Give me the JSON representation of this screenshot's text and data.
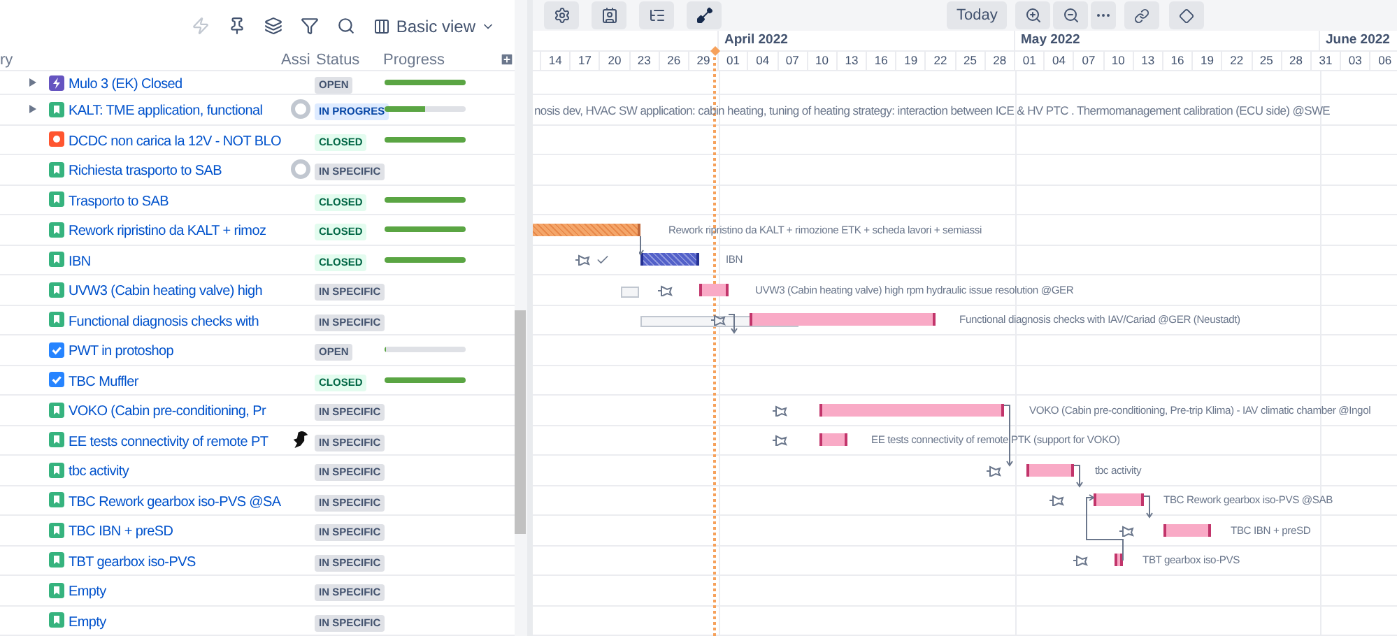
{
  "toolbar": {
    "view_button": "Basic view"
  },
  "table": {
    "columns": [
      "ry",
      "Assi",
      "Status",
      "Progress"
    ],
    "rows": [
      {
        "kind": "epic",
        "summary": "Mulo 3 (EK) Closed",
        "expanded": false,
        "status": {
          "label": "OPEN",
          "kind": "open"
        },
        "progress": {
          "level": 1
        }
      },
      {
        "kind": "story",
        "summary": "KALT: TME application, functional",
        "expanded": false,
        "avatar": {
          "kind": "default"
        },
        "status": {
          "label": "IN PROGRES",
          "kind": "progress"
        },
        "progress": {
          "level": 0.5
        },
        "timeline": {
          "label": "nosis dev, HVAC SW application: cabin heating, tuning of heating strategy: interaction between ICE & HV PTC . Thermomanagement calibration (ECU side) @SWE"
        }
      },
      {
        "kind": "bug",
        "summary": "DCDC non carica la 12V - NOT BLO",
        "status": {
          "label": "CLOSED",
          "kind": "closed"
        },
        "progress": {
          "level": 1
        }
      },
      {
        "kind": "story",
        "summary": "Richiesta trasporto to SAB",
        "avatar": {
          "kind": "default"
        },
        "status": {
          "label": "IN SPECIFIC",
          "kind": "open"
        }
      },
      {
        "kind": "story",
        "summary": "Trasporto to SAB",
        "status": {
          "label": "CLOSED",
          "kind": "closed"
        },
        "progress": {
          "level": 1
        }
      },
      {
        "kind": "story",
        "summary": "Rework ripristino da KALT + rimoz",
        "status": {
          "label": "CLOSED",
          "kind": "closed"
        },
        "progress": {
          "level": 1
        },
        "timeline": {
          "kind": "hatched",
          "label": "Rework ripristino da KALT + rimozione ETK + scheda lavori + semiassi"
        }
      },
      {
        "kind": "story",
        "summary": "IBN",
        "status": {
          "label": "CLOSED",
          "kind": "closed"
        },
        "progress": {
          "level": 1
        },
        "timeline": {
          "kind": "done",
          "label": "IBN"
        }
      },
      {
        "kind": "story",
        "summary": "UVW3 (Cabin heating valve) high",
        "status": {
          "label": "IN SPECIFIC",
          "kind": "open"
        },
        "timeline": {
          "kind": "planned",
          "label": "UVW3 (Cabin heating valve) high rpm hydraulic issue resolution @GER"
        }
      },
      {
        "kind": "story",
        "summary": "Functional diagnosis checks with",
        "status": {
          "label": "IN SPECIFIC",
          "kind": "open"
        },
        "timeline": {
          "kind": "planned",
          "label": "Functional diagnosis checks with IAV/Cariad @GER (Neustadt)"
        }
      },
      {
        "kind": "task",
        "summary": "PWT in protoshop",
        "status": {
          "label": "OPEN",
          "kind": "open"
        },
        "progress": {
          "level": 0
        }
      },
      {
        "kind": "task",
        "summary": "TBC Muffler",
        "status": {
          "label": "CLOSED",
          "kind": "closed"
        },
        "progress": {
          "level": 1
        }
      },
      {
        "kind": "story",
        "summary": "VOKO (Cabin pre-conditioning, Pr",
        "status": {
          "label": "IN SPECIFIC",
          "kind": "open"
        },
        "timeline": {
          "kind": "planned",
          "label": "VOKO (Cabin pre-conditioning, Pre-trip Klima) - IAV climatic chamber @Ingol"
        }
      },
      {
        "kind": "story",
        "summary": "EE tests connectivity of remote PT",
        "status": {
          "label": "IN SPECIFIC",
          "kind": "open"
        },
        "timeline": {
          "kind": "planned",
          "label": "EE tests connectivity of remote PTK (support for VOKO)"
        }
      },
      {
        "kind": "story",
        "summary": "tbc activity",
        "status": {
          "label": "IN SPECIFIC",
          "kind": "open"
        },
        "timeline": {
          "kind": "planned",
          "label": "tbc activity"
        }
      },
      {
        "kind": "story",
        "summary": "TBC Rework gearbox iso-PVS @SA",
        "status": {
          "label": "IN SPECIFIC",
          "kind": "open"
        },
        "timeline": {
          "kind": "planned",
          "label": "TBC Rework gearbox iso-PVS @SAB"
        }
      },
      {
        "kind": "story",
        "summary": "TBC IBN + preSD",
        "status": {
          "label": "IN SPECIFIC",
          "kind": "open"
        },
        "timeline": {
          "kind": "planned",
          "label": "TBC IBN + preSD"
        }
      },
      {
        "kind": "story",
        "summary": "TBT gearbox iso-PVS",
        "status": {
          "label": "IN SPECIFIC",
          "kind": "open"
        },
        "timeline": {
          "kind": "planned",
          "label": "TBT gearbox iso-PVS"
        }
      },
      {
        "kind": "story",
        "summary": "Empty",
        "status": {
          "label": "IN SPECIFIC",
          "kind": "open"
        }
      },
      {
        "kind": "story",
        "summary": "Empty",
        "status": {
          "label": "IN SPECIFIC",
          "kind": "open"
        }
      }
    ]
  },
  "gantt": {
    "today_button": "Today",
    "months": [
      "April 2022",
      "May 2022",
      "June 2022"
    ],
    "days": [
      "14",
      "17",
      "20",
      "23",
      "26",
      "29",
      "01",
      "04",
      "07",
      "10",
      "13",
      "16",
      "19",
      "22",
      "25",
      "28",
      "01",
      "04",
      "07",
      "10",
      "13",
      "16",
      "19",
      "22",
      "25",
      "28",
      "31",
      "03",
      "06"
    ]
  }
}
